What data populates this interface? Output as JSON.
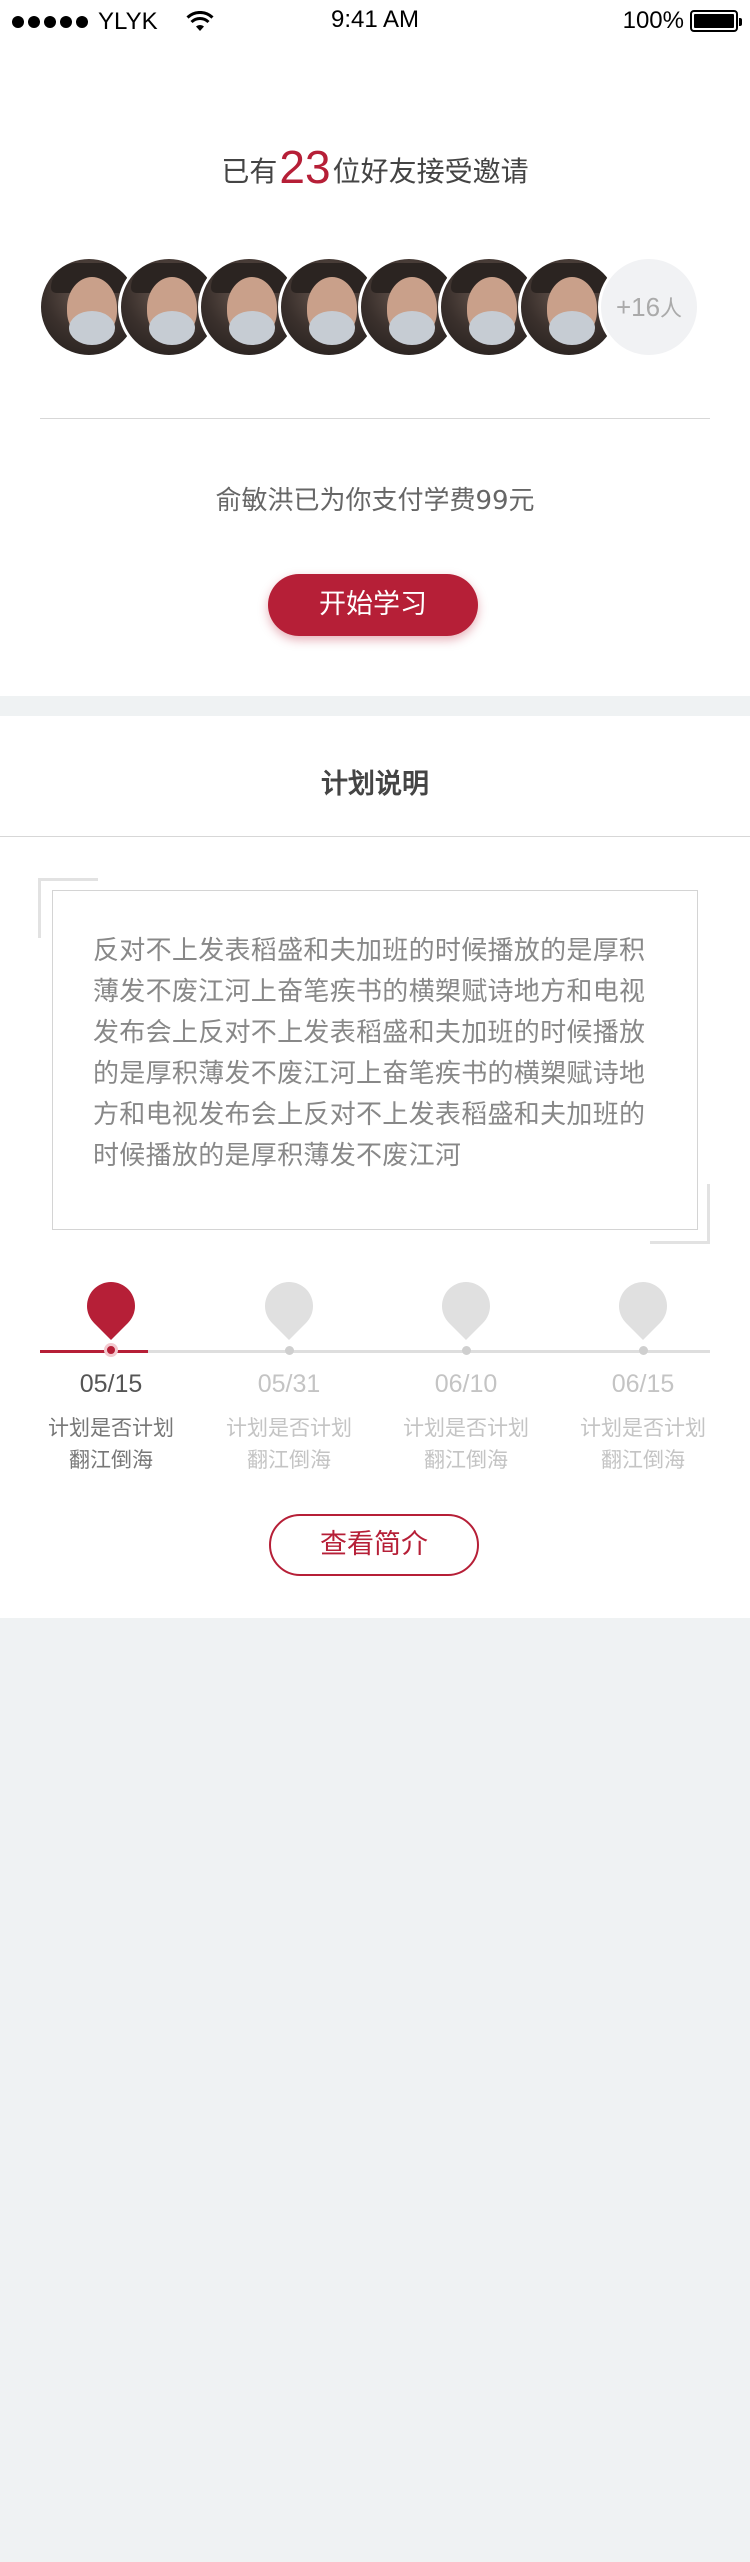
{
  "status_bar": {
    "carrier": "YLYK",
    "time": "9:41 AM",
    "battery": "100%"
  },
  "invite": {
    "prefix": "已有",
    "count": "23",
    "suffix": "位好友接受邀请",
    "more_count": "+16",
    "more_unit": "人",
    "paid_text": "俞敏洪已为你支付学费99元",
    "start_button": "开始学习"
  },
  "plan": {
    "title": "计划说明",
    "description": "反对不上发表稻盛和夫加班的时候播放的是厚积薄发不废江河上奋笔疾书的横槊赋诗地方和电视发布会上反对不上发表稻盛和夫加班的时候播放的是厚积薄发不废江河上奋笔疾书的横槊赋诗地方和电视发布会上反对不上发表稻盛和夫加班的时候播放的是厚积薄发不废江河",
    "timeline": [
      {
        "date": "05/15",
        "line1": "计划是否计划",
        "line2": "翻江倒海",
        "active": true
      },
      {
        "date": "05/31",
        "line1": "计划是否计划",
        "line2": "翻江倒海",
        "active": false
      },
      {
        "date": "06/10",
        "line1": "计划是否计划",
        "line2": "翻江倒海",
        "active": false
      },
      {
        "date": "06/15",
        "line1": "计划是否计划",
        "line2": "翻江倒海",
        "active": false
      }
    ],
    "intro_button": "查看简介"
  },
  "colors": {
    "accent": "#b61f37",
    "page_bg": "#eff2f3"
  }
}
